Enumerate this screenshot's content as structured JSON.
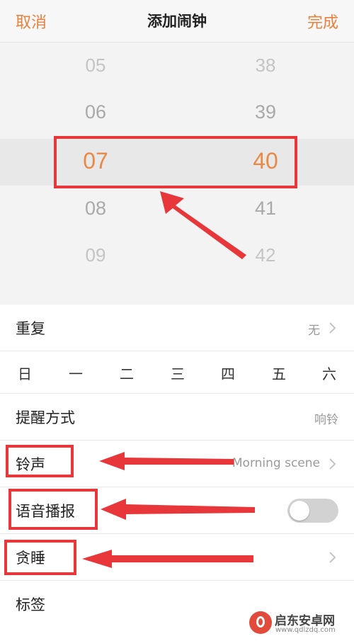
{
  "header": {
    "cancel_label": "取消",
    "title": "添加闹钟",
    "done_label": "完成"
  },
  "picker": {
    "hours": [
      "05",
      "06",
      "07",
      "08",
      "09"
    ],
    "minutes": [
      "38",
      "39",
      "40",
      "41",
      "42"
    ],
    "selected_hour": "07",
    "selected_minute": "40"
  },
  "settings": {
    "repeat": {
      "label": "重复",
      "value": "无"
    },
    "weekdays": [
      "日",
      "一",
      "二",
      "三",
      "四",
      "五",
      "六"
    ],
    "reminder": {
      "label": "提醒方式",
      "value": "响铃"
    },
    "ringtone": {
      "label": "铃声",
      "value": "Morning scene"
    },
    "voice_broadcast": {
      "label": "语音播报",
      "enabled": false
    },
    "snooze": {
      "label": "贪睡"
    },
    "tag": {
      "label": "标签"
    }
  },
  "watermark": {
    "title": "启东安卓网",
    "url": "www.qdlzdq.com"
  },
  "colors": {
    "accent": "#e9813e",
    "annotation": "#e8373b",
    "toggle_off": "#d2d2d2"
  }
}
